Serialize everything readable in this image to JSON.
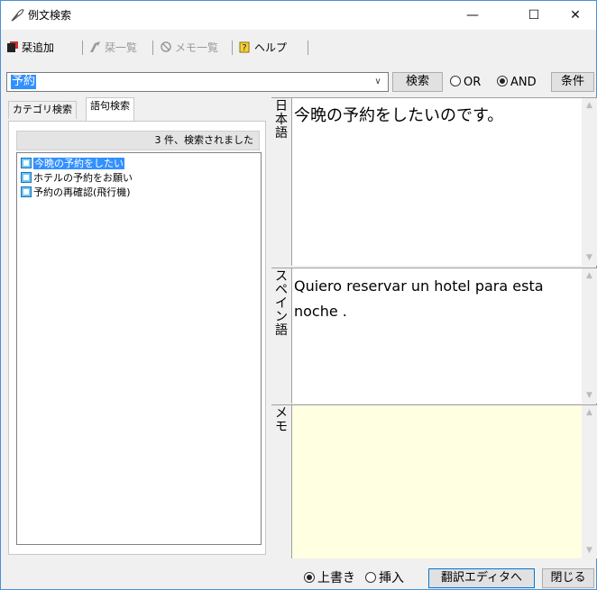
{
  "window": {
    "title": "例文検索",
    "minimize_glyph": "—",
    "maximize_glyph": "☐",
    "close_glyph": "✕",
    "icon": "feather-pen-icon"
  },
  "toolbar": {
    "add_label": "栞追加",
    "list_label": "栞一覧",
    "memo_list_label": "メモ一覧",
    "help_label": "ヘルプ"
  },
  "search": {
    "query": "予約",
    "dropdown_glyph": "∨",
    "search_button": "検索",
    "or_label": "OR",
    "and_label": "AND",
    "mode": "AND",
    "conditions_button": "条件"
  },
  "left": {
    "tabs": [
      {
        "label": "カテゴリ検索",
        "active": false
      },
      {
        "label": "語句検索",
        "active": true
      }
    ],
    "count_text": "3 件、検索されました",
    "results": [
      {
        "label": "今晩の予約をしたい",
        "selected": true
      },
      {
        "label": "ホテルの予約をお願い",
        "selected": false
      },
      {
        "label": "予約の再確認(飛行機)",
        "selected": false
      }
    ]
  },
  "right": {
    "japanese": {
      "label_chars": [
        "日",
        "本",
        "語"
      ],
      "text": "今晩の予約をしたいのです。"
    },
    "spanish": {
      "label_chars": [
        "ス",
        "ペ",
        "イ",
        "ン",
        "語"
      ],
      "text": "Quiero reservar un hotel para esta noche ."
    },
    "memo": {
      "label_chars": [
        "メ",
        "モ"
      ],
      "text": ""
    }
  },
  "bottom": {
    "overwrite_label": "上書き",
    "insert_label": "挿入",
    "mode": "overwrite",
    "translate_button": "翻訳エディタへ",
    "close_button": "閉じる"
  },
  "colors": {
    "selection": "#3390ff",
    "memo_bg": "#ffffe1",
    "window_border": "#4a8fd8"
  }
}
